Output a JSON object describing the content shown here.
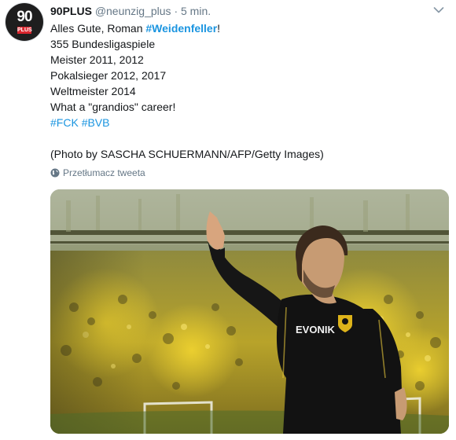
{
  "tweet": {
    "author": {
      "name": "90PLUS",
      "handle": "@neunzig_plus",
      "avatar_text": "90",
      "avatar_subtext": "PLUS"
    },
    "separator": "·",
    "time": "5 min.",
    "text": {
      "line1_prefix": "Alles Gute, Roman ",
      "line1_hashtag": "#Weidenfeller",
      "line1_suffix": "!",
      "line2": "355 Bundesligaspiele",
      "line3": "Meister 2011, 2012",
      "line4": "Pokalsieger 2012, 2017",
      "line5": "Weltmeister 2014",
      "line6": "What a \"grandios\" career!",
      "hashtags": [
        "#FCK",
        "#BVB"
      ],
      "credit": "(Photo by SASCHA SCHUERMANN/AFP/Getty Images)"
    },
    "translate_label": "Przetłumacz tweeta",
    "photo": {
      "jersey_sponsor": "EVONIK"
    }
  },
  "icons": {
    "menu": "chevron-down-icon",
    "translate": "globe-icon"
  }
}
